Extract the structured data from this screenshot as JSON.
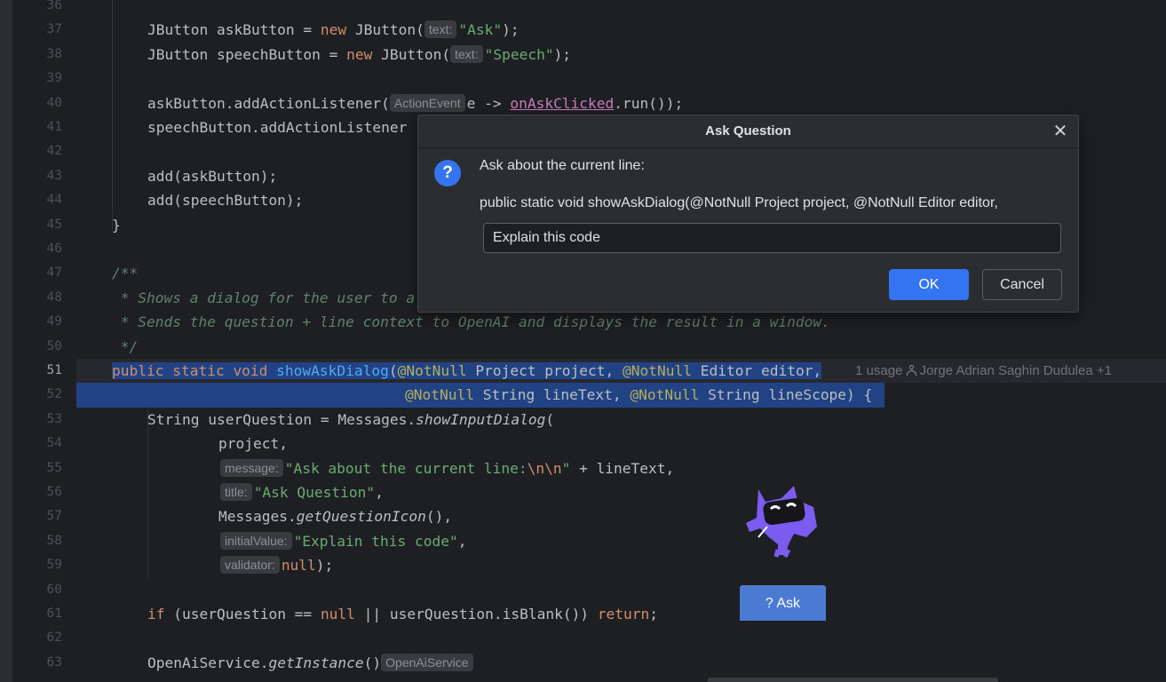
{
  "editor": {
    "lines": [
      {
        "n": "36"
      },
      {
        "n": "37"
      },
      {
        "n": "38"
      },
      {
        "n": "39"
      },
      {
        "n": "40"
      },
      {
        "n": "41"
      },
      {
        "n": "42"
      },
      {
        "n": "43"
      },
      {
        "n": "44"
      },
      {
        "n": "45"
      },
      {
        "n": "46"
      },
      {
        "n": "47"
      },
      {
        "n": "48"
      },
      {
        "n": "49"
      },
      {
        "n": "50"
      },
      {
        "n": "51"
      },
      {
        "n": "52"
      },
      {
        "n": "53"
      },
      {
        "n": "54"
      },
      {
        "n": "55"
      },
      {
        "n": "56"
      },
      {
        "n": "57"
      },
      {
        "n": "58"
      },
      {
        "n": "59"
      },
      {
        "n": "60"
      },
      {
        "n": "61"
      },
      {
        "n": "62"
      },
      {
        "n": "63"
      }
    ],
    "code": {
      "l37": {
        "a": "JButton askButton = ",
        "kw": "new",
        "b": " JButton(",
        "hint": "text:",
        "str": "\"Ask\"",
        "c": ");"
      },
      "l38": {
        "a": "JButton speechButton = ",
        "kw": "new",
        "b": " JButton(",
        "hint": "text:",
        "str": "\"Speech\"",
        "c": ");"
      },
      "l40": {
        "a": "askButton.addActionListener(",
        "hint": "ActionEvent",
        "b": "e -> ",
        "link": "onAskClicked",
        "c": ".run());"
      },
      "l41": {
        "a": "speechButton.addActionListener"
      },
      "l43": {
        "a": "add(askButton);"
      },
      "l44": {
        "a": "add(speechButton);"
      },
      "l45": {
        "a": "}"
      },
      "l47": {
        "a": "/**"
      },
      "l48": {
        "a": " * Shows a dialog for the user to a"
      },
      "l49": {
        "a": " * Sends the question + line context to OpenAI and displays the result in a window."
      },
      "l50": {
        "a": " */"
      },
      "l51": {
        "kw1": "public static void ",
        "fn": "showAskDialog",
        "p1": "(",
        "ann1": "@NotNull",
        "p2": " Project project, ",
        "ann2": "@NotNull",
        "p3": " Editor editor,"
      },
      "l52": {
        "ann1": "@NotNull",
        "p1": " String lineText, ",
        "ann2": "@NotNull",
        "p2": " String lineScope) {"
      },
      "l53": {
        "a": "String userQuestion = Messages.",
        "it": "showInputDialog",
        "b": "("
      },
      "l54": {
        "a": "project,"
      },
      "l55": {
        "hint": "message:",
        "str": "\"Ask about the current line:",
        "esc": "\\n\\n",
        "str2": "\"",
        "b": " + lineText,"
      },
      "l56": {
        "hint": "title:",
        "str": "\"Ask Question\"",
        "b": ","
      },
      "l57": {
        "a": "Messages.",
        "it": "getQuestionIcon",
        "b": "(),"
      },
      "l58": {
        "hint": "initialValue:",
        "str": "\"Explain this code\"",
        "b": ","
      },
      "l59": {
        "hint": "validator:",
        "kw": "null",
        "b": ");"
      },
      "l61": {
        "kw": "if",
        "a": " (userQuestion == ",
        "kw2": "null",
        "b": " || userQuestion.isBlank()) ",
        "kw3": "return",
        "c": ";"
      },
      "l63": {
        "a": "OpenAiService.",
        "it": "getInstance",
        "b": "()",
        "hint": "OpenAiService"
      }
    },
    "usages": "1 usage",
    "author": "Jorge Adrian Saghin Dudulea +1"
  },
  "dialog": {
    "title": "Ask Question",
    "message": "Ask about the current line:",
    "line_text": "public static void showAskDialog(@NotNull Project project, @NotNull Editor editor,",
    "input_value": "Explain this code",
    "ok_label": "OK",
    "cancel_label": "Cancel",
    "icon": "question-icon",
    "close_icon": "close-icon"
  },
  "ask_button": {
    "label": "? Ask"
  },
  "colors": {
    "accent": "#3574f0",
    "selection": "#214283",
    "mascot": "#7b5cf0"
  }
}
